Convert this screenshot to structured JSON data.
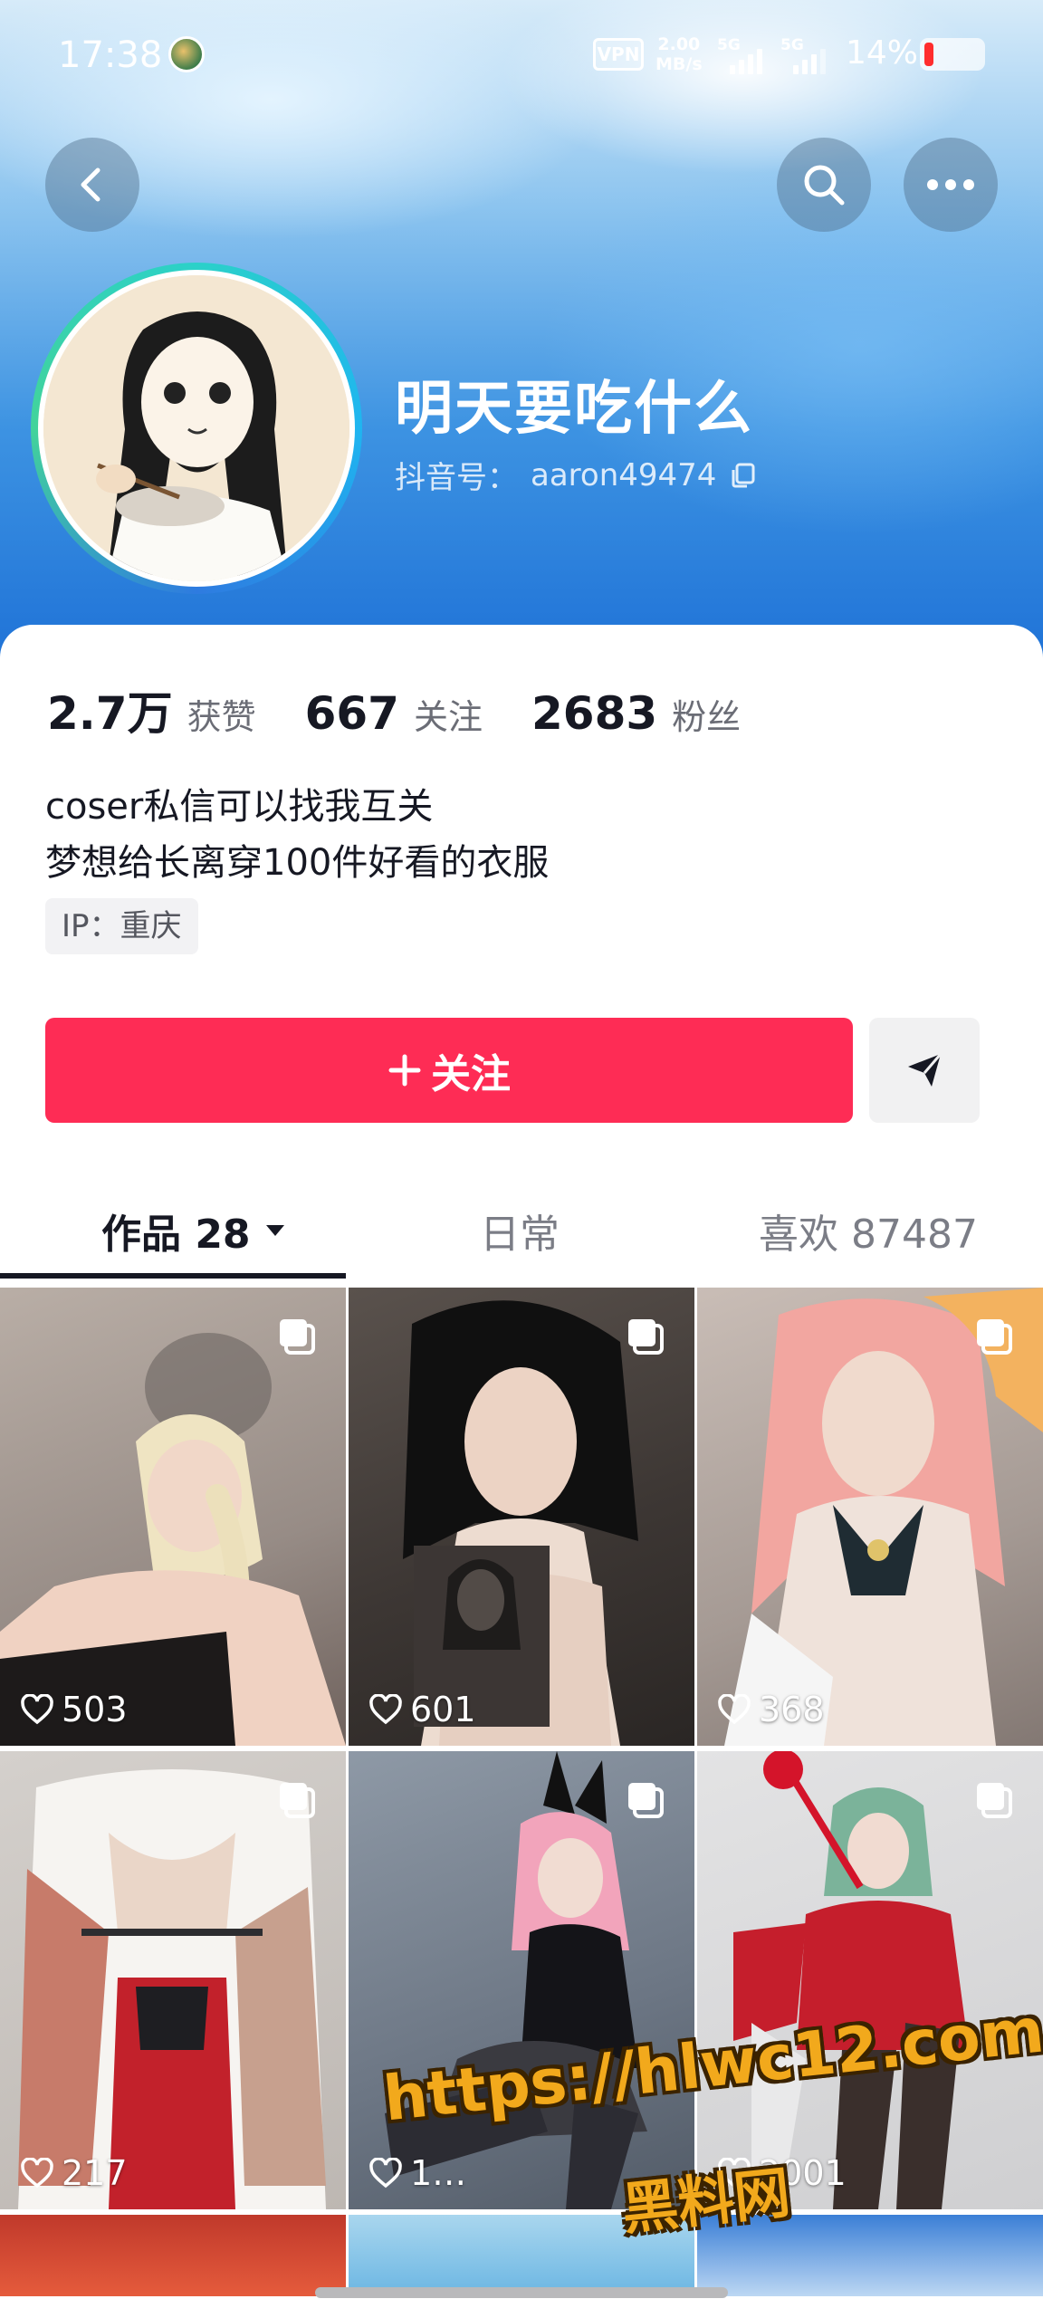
{
  "status_bar": {
    "time": "17:38",
    "vpn": "VPN",
    "speed_value": "2.00",
    "speed_unit": "MB/s",
    "sim1": "5G",
    "sim2": "5G",
    "battery": "14%"
  },
  "header": {
    "name": "明天要吃什么",
    "douyin_id_label": "抖音号：",
    "douyin_id": "aaron49474"
  },
  "stats": [
    {
      "value": "2.7万",
      "label": "获赞"
    },
    {
      "value": "667",
      "label": "关注"
    },
    {
      "value": "2683",
      "label": "粉丝"
    }
  ],
  "bio": {
    "line1": "coser私信可以找我互关",
    "line2": "梦想给长离穿100件好看的衣服"
  },
  "ip": "IP：重庆",
  "actions": {
    "follow_label": "关注"
  },
  "tabs": [
    {
      "label": "作品 28",
      "active": true
    },
    {
      "label": "日常",
      "active": false
    },
    {
      "label": "喜欢 87487",
      "active": false
    }
  ],
  "posts": [
    {
      "likes": "503"
    },
    {
      "likes": "601"
    },
    {
      "likes": "368"
    },
    {
      "likes": "217"
    },
    {
      "likes": "1…"
    },
    {
      "likes": "2001"
    }
  ],
  "watermark": {
    "url": "https://hlwc12.com",
    "name": "黑料网"
  },
  "colors": {
    "accent": "#fe2c55",
    "text": "#161823",
    "muted": "#7b7d86"
  }
}
